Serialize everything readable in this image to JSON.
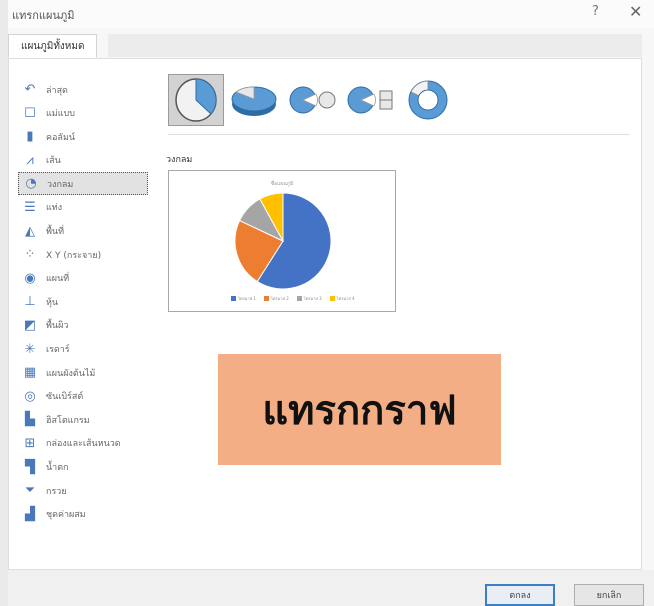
{
  "window": {
    "title": "แทรกแผนภูมิ",
    "help_glyph": "?",
    "close_glyph": "✕"
  },
  "tabs": [
    {
      "label": "แผนภูมิทั้งหมด"
    }
  ],
  "sidebar": {
    "items": [
      {
        "label": "ล่าสุด",
        "icon": "recent-icon",
        "glyph": "↶"
      },
      {
        "label": "แม่แบบ",
        "icon": "template-icon",
        "glyph": "☐"
      },
      {
        "label": "คอลัมน์",
        "icon": "column-chart-icon",
        "glyph": "▮"
      },
      {
        "label": "เส้น",
        "icon": "line-chart-icon",
        "glyph": "⩘"
      },
      {
        "label": "วงกลม",
        "icon": "pie-chart-icon",
        "glyph": "◔"
      },
      {
        "label": "แท่ง",
        "icon": "bar-chart-icon",
        "glyph": "☰"
      },
      {
        "label": "พื้นที่",
        "icon": "area-chart-icon",
        "glyph": "◭"
      },
      {
        "label": "X Y (กระจาย)",
        "icon": "scatter-chart-icon",
        "glyph": "⁘"
      },
      {
        "label": "แผนที่",
        "icon": "map-chart-icon",
        "glyph": "◉"
      },
      {
        "label": "หุ้น",
        "icon": "stock-chart-icon",
        "glyph": "⊥"
      },
      {
        "label": "พื้นผิว",
        "icon": "surface-chart-icon",
        "glyph": "◩"
      },
      {
        "label": "เรดาร์",
        "icon": "radar-chart-icon",
        "glyph": "✳"
      },
      {
        "label": "แผนผังต้นไม้",
        "icon": "treemap-chart-icon",
        "glyph": "▦"
      },
      {
        "label": "ซันเบิร์สต์",
        "icon": "sunburst-chart-icon",
        "glyph": "◎"
      },
      {
        "label": "ฮิสโตแกรม",
        "icon": "histogram-chart-icon",
        "glyph": "▙"
      },
      {
        "label": "กล่องและเส้นหนวด",
        "icon": "box-whisker-chart-icon",
        "glyph": "⊞"
      },
      {
        "label": "น้ำตก",
        "icon": "waterfall-chart-icon",
        "glyph": "▜"
      },
      {
        "label": "กรวย",
        "icon": "funnel-chart-icon",
        "glyph": "⏷"
      },
      {
        "label": "ชุดค่าผสม",
        "icon": "combo-chart-icon",
        "glyph": "▟"
      }
    ],
    "selected_index": 4
  },
  "main": {
    "variants": [
      {
        "name": "pie-variant-icon"
      },
      {
        "name": "3d-pie-variant-icon"
      },
      {
        "name": "pie-of-pie-variant-icon"
      },
      {
        "name": "bar-of-pie-variant-icon"
      },
      {
        "name": "doughnut-variant-icon"
      }
    ],
    "selected_variant": 0,
    "section_label": "วงกลม",
    "preview": {
      "title": "ชื่อแผนภูมิ",
      "legend": [
        {
          "label": "ไตรมาส 1",
          "color": "#4472c4"
        },
        {
          "label": "ไตรมาส 2",
          "color": "#ed7d31"
        },
        {
          "label": "ไตรมาส 3",
          "color": "#a5a5a5"
        },
        {
          "label": "ไตรมาส 4",
          "color": "#ffc000"
        }
      ]
    }
  },
  "chart_data": {
    "type": "pie",
    "categories": [
      "ไตรมาส 1",
      "ไตรมาส 2",
      "ไตรมาส 3",
      "ไตรมาส 4"
    ],
    "values": [
      59,
      23,
      10,
      8
    ],
    "colors": [
      "#4472c4",
      "#ed7d31",
      "#a5a5a5",
      "#ffc000"
    ]
  },
  "overlay": {
    "text": "แทรกกราฟ",
    "color": "#f4ae85"
  },
  "buttons": {
    "ok": "ตกลง",
    "cancel": "ยกเลิก"
  }
}
